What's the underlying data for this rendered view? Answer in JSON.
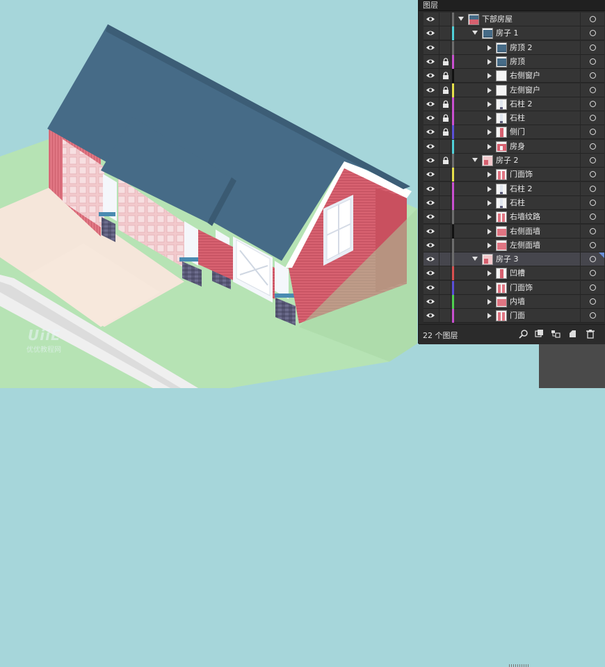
{
  "panel": {
    "tab_title": "图层",
    "layer_count": "22 个图层",
    "footer_icons": [
      "search-icon",
      "make-clipping-mask-icon",
      "create-sublayer-icon",
      "new-layer-icon",
      "delete-icon"
    ]
  },
  "layers": [
    {
      "name": "下部房屋",
      "level": 0,
      "expanded": true,
      "locked": false,
      "color": "#6c6c6c",
      "selected": false,
      "thumb": "house"
    },
    {
      "name": "房子 1",
      "level": 1,
      "expanded": true,
      "locked": false,
      "color": "#4fd0d8",
      "selected": false,
      "thumb": "roof"
    },
    {
      "name": "房顶 2",
      "level": 2,
      "expanded": false,
      "locked": false,
      "color": "#6c6c6c",
      "selected": false,
      "thumb": "roof"
    },
    {
      "name": "房顶",
      "level": 2,
      "expanded": false,
      "locked": true,
      "color": "#c94fd0",
      "selected": false,
      "thumb": "roof"
    },
    {
      "name": "右侧窗户",
      "level": 2,
      "expanded": false,
      "locked": true,
      "color": "#111111",
      "selected": false,
      "thumb": "blank"
    },
    {
      "name": "左侧窗户",
      "level": 2,
      "expanded": false,
      "locked": true,
      "color": "#e6e04a",
      "selected": false,
      "thumb": "blank"
    },
    {
      "name": "石柱 2",
      "level": 2,
      "expanded": false,
      "locked": true,
      "color": "#c94fd0",
      "selected": false,
      "thumb": "pillar"
    },
    {
      "name": "石柱",
      "level": 2,
      "expanded": false,
      "locked": true,
      "color": "#c94fd0",
      "selected": false,
      "thumb": "pillar"
    },
    {
      "name": "侧门",
      "level": 2,
      "expanded": false,
      "locked": true,
      "color": "#5a4fd8",
      "selected": false,
      "thumb": "door"
    },
    {
      "name": "房身",
      "level": 2,
      "expanded": false,
      "locked": false,
      "color": "#4fd0d8",
      "selected": false,
      "thumb": "body"
    },
    {
      "name": "房子 2",
      "level": 1,
      "expanded": true,
      "locked": true,
      "color": "#6c6c6c",
      "selected": false,
      "thumb": "house2"
    },
    {
      "name": "门面饰",
      "level": 2,
      "expanded": false,
      "locked": false,
      "color": "#e6e04a",
      "selected": false,
      "thumb": "stripe"
    },
    {
      "name": "石柱 2",
      "level": 2,
      "expanded": false,
      "locked": false,
      "color": "#c94fd0",
      "selected": false,
      "thumb": "pillar"
    },
    {
      "name": "石柱",
      "level": 2,
      "expanded": false,
      "locked": false,
      "color": "#c94fd0",
      "selected": false,
      "thumb": "pillar"
    },
    {
      "name": "右墙纹路",
      "level": 2,
      "expanded": false,
      "locked": false,
      "color": "#6c6c6c",
      "selected": false,
      "thumb": "stripe"
    },
    {
      "name": "右侧面墙",
      "level": 2,
      "expanded": false,
      "locked": false,
      "color": "#111111",
      "selected": false,
      "thumb": "wall"
    },
    {
      "name": "左侧面墙",
      "level": 2,
      "expanded": false,
      "locked": false,
      "color": "#6c6c6c",
      "selected": false,
      "thumb": "wall"
    },
    {
      "name": "房子 3",
      "level": 1,
      "expanded": true,
      "locked": false,
      "color": "#6c6c6c",
      "selected": true,
      "thumb": "house2"
    },
    {
      "name": "凹槽",
      "level": 2,
      "expanded": false,
      "locked": false,
      "color": "#d84f4f",
      "selected": false,
      "thumb": "door"
    },
    {
      "name": "门面饰",
      "level": 2,
      "expanded": false,
      "locked": false,
      "color": "#5a4fd8",
      "selected": false,
      "thumb": "stripe"
    },
    {
      "name": "内墙",
      "level": 2,
      "expanded": false,
      "locked": false,
      "color": "#4fd04f",
      "selected": false,
      "thumb": "wall"
    },
    {
      "name": "门面",
      "level": 2,
      "expanded": false,
      "locked": false,
      "color": "#c94fd0",
      "selected": false,
      "thumb": "stripe"
    }
  ],
  "watermark": {
    "logo": "UiiE",
    "text": "优优教程网"
  }
}
